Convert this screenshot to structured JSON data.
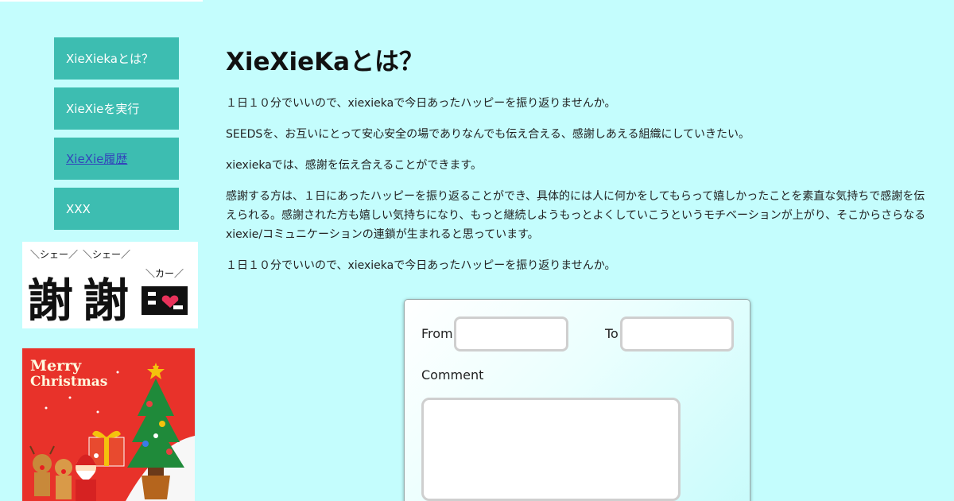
{
  "nav": {
    "items": [
      {
        "label": "XieXiekaとは？"
      },
      {
        "label": "XieXieを実行"
      },
      {
        "label": "XieXie履歴"
      },
      {
        "label": "XXX"
      }
    ]
  },
  "logo": {
    "sound_left": "＼シェー／",
    "sound_mid": "＼シェー／",
    "sound_right": "＼カー／",
    "kanji_1": "謝",
    "kanji_2": "謝"
  },
  "banner": {
    "line1": "Merry",
    "line2": "Christmas"
  },
  "main": {
    "title": "XieXieKaとは？",
    "paragraphs": [
      "１日１０分でいいので、xiexiekaで今日あったハッピーを振り返りませんか。",
      "SEEDSを、お互いにとって安心安全の場でありなんでも伝え合える、感謝しあえる組織にしていきたい。",
      "xiexiekaでは、感謝を伝え合えることができます。",
      "感謝する方は、１日にあったハッピーを振り返ることができ、具体的には人に何かをしてもらって嬉しかったことを素直な気持ちで感謝を伝えられる。感謝された方も嬉しい気持ちになり、もっと継続しようもっとよくしていこうというモチベーションが上がり、そこからさらなるxiexie/コミュニケーションの連鎖が生まれると思っています。",
      "１日１０分でいいので、xiexiekaで今日あったハッピーを振り返りませんか。"
    ]
  },
  "form": {
    "from_label": "From",
    "to_label": "To",
    "comment_label": "Comment",
    "from_value": "",
    "to_value": "",
    "comment_value": ""
  },
  "colors": {
    "background": "#c4fdfd",
    "nav_button": "#3dbdb1",
    "banner_red": "#e8322a"
  }
}
